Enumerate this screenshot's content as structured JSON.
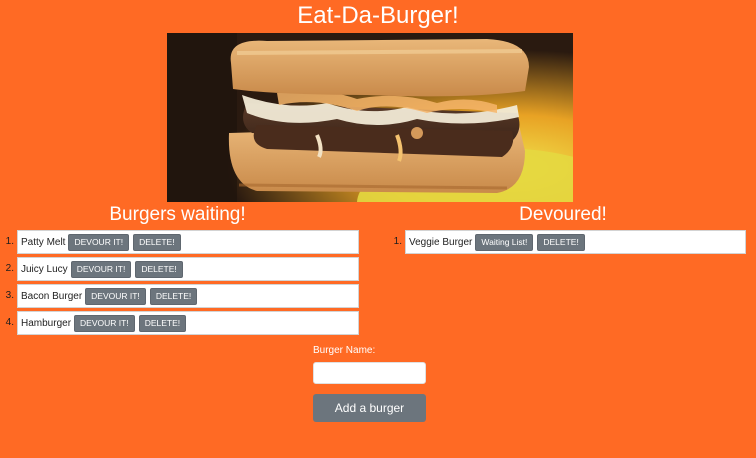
{
  "header": {
    "title": "Eat-Da-Burger!"
  },
  "hero": {
    "icon": "burger-photo"
  },
  "waiting": {
    "title": "Burgers waiting!",
    "items": [
      {
        "num": "1.",
        "name": "Patty Melt",
        "devour_label": "DEVOUR IT!",
        "delete_label": "DELETE!"
      },
      {
        "num": "2.",
        "name": "Juicy Lucy",
        "devour_label": "DEVOUR IT!",
        "delete_label": "DELETE!"
      },
      {
        "num": "3.",
        "name": "Bacon Burger",
        "devour_label": "DEVOUR IT!",
        "delete_label": "DELETE!"
      },
      {
        "num": "4.",
        "name": "Hamburger",
        "devour_label": "DEVOUR IT!",
        "delete_label": "DELETE!"
      }
    ]
  },
  "devoured": {
    "title": "Devoured!",
    "items": [
      {
        "num": "1.",
        "name": "Veggie Burger",
        "waiting_label": "Waiting List!",
        "delete_label": "DELETE!"
      }
    ]
  },
  "form": {
    "label": "Burger Name:",
    "value": "",
    "placeholder": "",
    "submit_label": "Add a burger"
  },
  "colors": {
    "background": "#ff6a24",
    "button": "#6c757d"
  }
}
